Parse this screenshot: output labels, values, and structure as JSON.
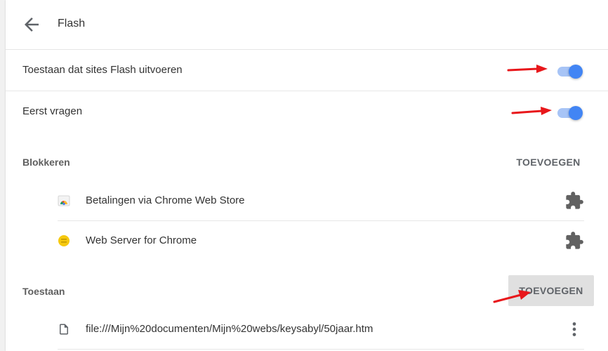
{
  "header": {
    "title": "Flash",
    "back_icon": "arrow-back-icon"
  },
  "toggles": [
    {
      "label": "Toestaan dat sites Flash uitvoeren",
      "state": "on"
    },
    {
      "label": "Eerst vragen",
      "state": "on"
    }
  ],
  "block_section": {
    "title": "Blokkeren",
    "add_label": "TOEVOEGEN",
    "items": [
      {
        "label": "Betalingen via Chrome Web Store",
        "icon": "chrome-webstore-icon",
        "action_icon": "puzzle-extension-icon"
      },
      {
        "label": "Web Server for Chrome",
        "icon": "web-server-icon",
        "action_icon": "puzzle-extension-icon"
      }
    ]
  },
  "allow_section": {
    "title": "Toestaan",
    "add_label": "TOEVOEGEN",
    "items": [
      {
        "label": "file:///Mijn%20documenten/Mijn%20webs/keysabyl/50jaar.htm",
        "icon": "file-icon",
        "action_icon": "more-vert-icon"
      }
    ]
  },
  "colors": {
    "toggle_on": "#4285f4",
    "toggle_track": "#a7c4f6",
    "annotation_arrow": "#e8171b",
    "hover_button_bg": "#e0e0e0"
  }
}
